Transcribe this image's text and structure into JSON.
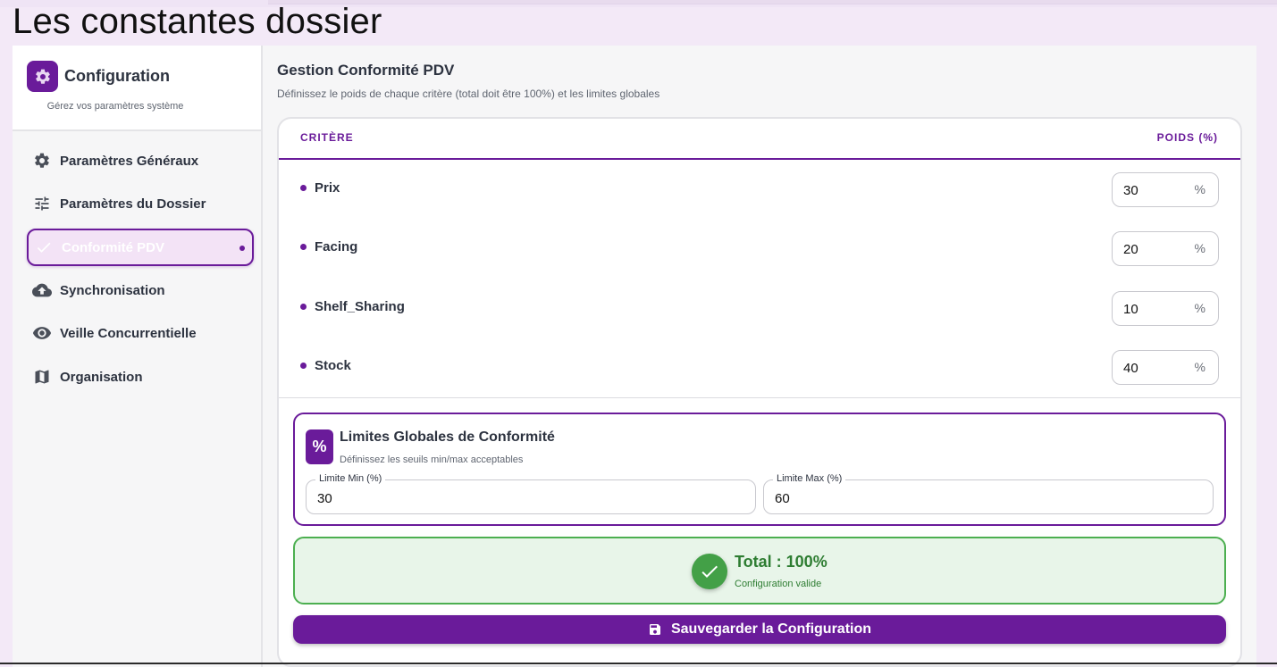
{
  "page_title": "Les constantes dossier",
  "sidebar": {
    "title": "Configuration",
    "subtitle": "Gérez vos paramètres système",
    "items": [
      {
        "label": "Paramètres Généraux"
      },
      {
        "label": "Paramètres du Dossier"
      },
      {
        "label": "Conformité PDV"
      },
      {
        "label": "Synchronisation"
      },
      {
        "label": "Veille Concurrentielle"
      },
      {
        "label": "Organisation"
      }
    ]
  },
  "main": {
    "title": "Gestion Conformité PDV",
    "subtitle": "Définissez le poids de chaque critère (total doit être 100%) et les limites globales",
    "table": {
      "col_criteria": "CRITÈRE",
      "col_weight": "POIDS (%)",
      "unit": "%",
      "rows": [
        {
          "name": "Prix",
          "value": "30"
        },
        {
          "name": "Facing",
          "value": "20"
        },
        {
          "name": "Shelf_Sharing",
          "value": "10"
        },
        {
          "name": "Stock",
          "value": "40"
        }
      ]
    },
    "limits": {
      "icon_text": "%",
      "title": "Limites Globales de Conformité",
      "subtitle": "Définissez les seuils min/max acceptables",
      "min_label": "Limite Min (%)",
      "min_value": "30",
      "max_label": "Limite Max (%)",
      "max_value": "60"
    },
    "total": {
      "title": "Total : 100%",
      "subtitle": "Configuration valide"
    },
    "save_label": "Sauvegarder la Configuration"
  },
  "colors": {
    "primary": "#6a1b9a",
    "success": "#43a047",
    "success_bg": "#e8f5e9"
  }
}
